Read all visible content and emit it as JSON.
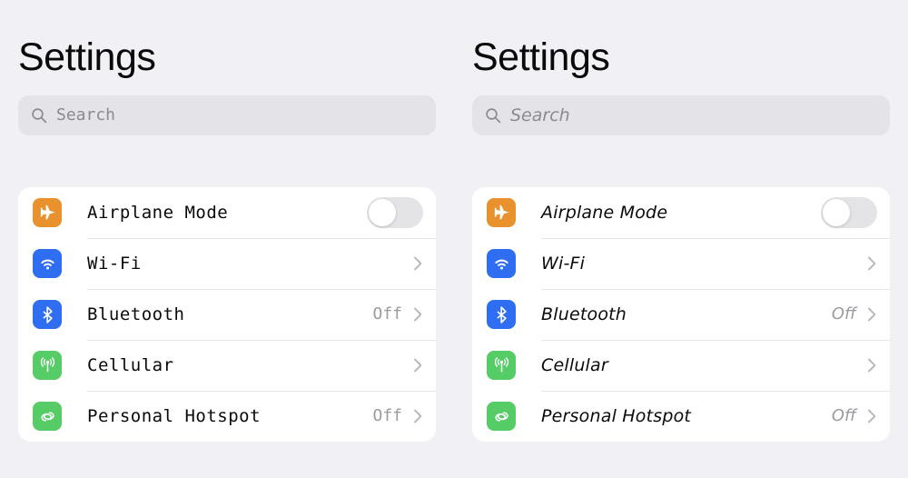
{
  "background_color": "#f1f1f5",
  "panels": [
    {
      "id": "left",
      "title": "Settings",
      "search": {
        "placeholder": "Search",
        "icon": "search-icon",
        "fill_color": "#e3e3e8"
      },
      "rows": [
        {
          "label": "Airplane Mode",
          "icon": "airplane-icon",
          "icon_color": "#e8912d",
          "control": "toggle",
          "toggle_on": false,
          "value": ""
        },
        {
          "label": "Wi-Fi",
          "icon": "wifi-icon",
          "icon_color": "#2f6ef0",
          "control": "chevron",
          "value": ""
        },
        {
          "label": "Bluetooth",
          "icon": "bluetooth-icon",
          "icon_color": "#2f6ef0",
          "control": "chevron",
          "value": "Off"
        },
        {
          "label": "Cellular",
          "icon": "cellular-icon",
          "icon_color": "#55cc66",
          "control": "chevron",
          "value": ""
        },
        {
          "label": "Personal Hotspot",
          "icon": "hotspot-icon",
          "icon_color": "#55cc66",
          "control": "chevron",
          "value": "Off"
        }
      ]
    },
    {
      "id": "right",
      "title": "Settings",
      "search": {
        "placeholder": "Search",
        "icon": "search-icon",
        "fill_color": "#e3e3e8"
      },
      "rows": [
        {
          "label": "Airplane Mode",
          "icon": "airplane-icon",
          "icon_color": "#e8912d",
          "control": "toggle",
          "toggle_on": false,
          "value": ""
        },
        {
          "label": "Wi-Fi",
          "icon": "wifi-icon",
          "icon_color": "#2f6ef0",
          "control": "chevron",
          "value": ""
        },
        {
          "label": "Bluetooth",
          "icon": "bluetooth-icon",
          "icon_color": "#2f6ef0",
          "control": "chevron",
          "value": "Off"
        },
        {
          "label": "Cellular",
          "icon": "cellular-icon",
          "icon_color": "#55cc66",
          "control": "chevron",
          "value": ""
        },
        {
          "label": "Personal Hotspot",
          "icon": "hotspot-icon",
          "icon_color": "#55cc66",
          "control": "chevron",
          "value": "Off"
        }
      ]
    }
  ]
}
